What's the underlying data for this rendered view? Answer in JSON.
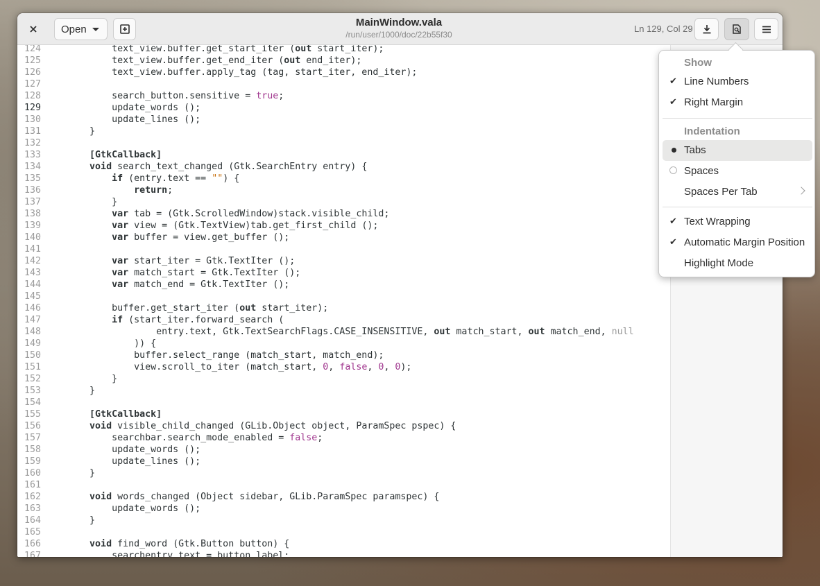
{
  "header": {
    "open_label": "Open",
    "title": "MainWindow.vala",
    "subtitle": "/run/user/1000/doc/22b55f30",
    "cursor_position": "Ln 129, Col 29"
  },
  "editor": {
    "current_line": 129,
    "lines": [
      {
        "n": 124,
        "t": [
          [
            "",
            "    text_view.buffer.get_start_iter ("
          ],
          [
            "kw",
            "out"
          ],
          [
            "",
            " start_iter);"
          ]
        ]
      },
      {
        "n": 125,
        "t": [
          [
            "",
            "    text_view.buffer.get_end_iter ("
          ],
          [
            "kw",
            "out"
          ],
          [
            "",
            " end_iter);"
          ]
        ]
      },
      {
        "n": 126,
        "t": [
          [
            "",
            "    text_view.buffer.apply_tag (tag, start_iter, end_iter);"
          ]
        ]
      },
      {
        "n": 127,
        "t": []
      },
      {
        "n": 128,
        "t": [
          [
            "",
            "    search_button.sensitive = "
          ],
          [
            "lit",
            "true"
          ],
          [
            "",
            ";"
          ]
        ]
      },
      {
        "n": 129,
        "t": [
          [
            "",
            "    update_words ();"
          ]
        ]
      },
      {
        "n": 130,
        "t": [
          [
            "",
            "    update_lines ();"
          ]
        ]
      },
      {
        "n": 131,
        "t": [
          [
            "",
            "}"
          ]
        ]
      },
      {
        "n": 132,
        "t": []
      },
      {
        "n": 133,
        "t": [
          [
            "kw",
            "[GtkCallback]"
          ]
        ]
      },
      {
        "n": 134,
        "t": [
          [
            "kw",
            "void"
          ],
          [
            "",
            " search_text_changed (Gtk.SearchEntry entry) {"
          ]
        ]
      },
      {
        "n": 135,
        "t": [
          [
            "",
            "    "
          ],
          [
            "kw",
            "if"
          ],
          [
            "",
            " (entry.text == "
          ],
          [
            "str",
            "\"\""
          ],
          [
            "",
            ") {"
          ]
        ]
      },
      {
        "n": 136,
        "t": [
          [
            "",
            "        "
          ],
          [
            "kw",
            "return"
          ],
          [
            "",
            ";"
          ]
        ]
      },
      {
        "n": 137,
        "t": [
          [
            "",
            "    }"
          ]
        ]
      },
      {
        "n": 138,
        "t": [
          [
            "",
            "    "
          ],
          [
            "kw",
            "var"
          ],
          [
            "",
            " tab = (Gtk.ScrolledWindow)stack.visible_child;"
          ]
        ]
      },
      {
        "n": 139,
        "t": [
          [
            "",
            "    "
          ],
          [
            "kw",
            "var"
          ],
          [
            "",
            " view = (Gtk.TextView)tab.get_first_child ();"
          ]
        ]
      },
      {
        "n": 140,
        "t": [
          [
            "",
            "    "
          ],
          [
            "kw",
            "var"
          ],
          [
            "",
            " buffer = view.get_buffer ();"
          ]
        ]
      },
      {
        "n": 141,
        "t": []
      },
      {
        "n": 142,
        "t": [
          [
            "",
            "    "
          ],
          [
            "kw",
            "var"
          ],
          [
            "",
            " start_iter = Gtk.TextIter ();"
          ]
        ]
      },
      {
        "n": 143,
        "t": [
          [
            "",
            "    "
          ],
          [
            "kw",
            "var"
          ],
          [
            "",
            " match_start = Gtk.TextIter ();"
          ]
        ]
      },
      {
        "n": 144,
        "t": [
          [
            "",
            "    "
          ],
          [
            "kw",
            "var"
          ],
          [
            "",
            " match_end = Gtk.TextIter ();"
          ]
        ]
      },
      {
        "n": 145,
        "t": []
      },
      {
        "n": 146,
        "t": [
          [
            "",
            "    buffer.get_start_iter ("
          ],
          [
            "kw",
            "out"
          ],
          [
            "",
            " start_iter);"
          ]
        ]
      },
      {
        "n": 147,
        "t": [
          [
            "",
            "    "
          ],
          [
            "kw",
            "if"
          ],
          [
            "",
            " (start_iter.forward_search ("
          ]
        ]
      },
      {
        "n": 148,
        "t": [
          [
            "",
            "            entry.text, Gtk.TextSearchFlags.CASE_INSENSITIVE, "
          ],
          [
            "kw",
            "out"
          ],
          [
            "",
            " match_start, "
          ],
          [
            "kw",
            "out"
          ],
          [
            "",
            " match_end, "
          ],
          [
            "dim",
            "null"
          ]
        ]
      },
      {
        "n": 149,
        "t": [
          [
            "",
            "        )) {"
          ]
        ]
      },
      {
        "n": 150,
        "t": [
          [
            "",
            "        buffer.select_range (match_start, match_end);"
          ]
        ]
      },
      {
        "n": 151,
        "t": [
          [
            "",
            "        view.scroll_to_iter (match_start, "
          ],
          [
            "lit",
            "0"
          ],
          [
            "",
            ", "
          ],
          [
            "lit",
            "false"
          ],
          [
            "",
            ", "
          ],
          [
            "lit",
            "0"
          ],
          [
            "",
            ", "
          ],
          [
            "lit",
            "0"
          ],
          [
            "",
            ");"
          ]
        ]
      },
      {
        "n": 152,
        "t": [
          [
            "",
            "    }"
          ]
        ]
      },
      {
        "n": 153,
        "t": [
          [
            "",
            "}"
          ]
        ]
      },
      {
        "n": 154,
        "t": []
      },
      {
        "n": 155,
        "t": [
          [
            "kw",
            "[GtkCallback]"
          ]
        ]
      },
      {
        "n": 156,
        "t": [
          [
            "kw",
            "void"
          ],
          [
            "",
            " visible_child_changed (GLib.Object object, ParamSpec pspec) {"
          ]
        ]
      },
      {
        "n": 157,
        "t": [
          [
            "",
            "    searchbar.search_mode_enabled = "
          ],
          [
            "lit",
            "false"
          ],
          [
            "",
            ";"
          ]
        ]
      },
      {
        "n": 158,
        "t": [
          [
            "",
            "    update_words ();"
          ]
        ]
      },
      {
        "n": 159,
        "t": [
          [
            "",
            "    update_lines ();"
          ]
        ]
      },
      {
        "n": 160,
        "t": [
          [
            "",
            "}"
          ]
        ]
      },
      {
        "n": 161,
        "t": []
      },
      {
        "n": 162,
        "t": [
          [
            "kw",
            "void"
          ],
          [
            "",
            " words_changed (Object sidebar, GLib.ParamSpec paramspec) {"
          ]
        ]
      },
      {
        "n": 163,
        "t": [
          [
            "",
            "    update_words ();"
          ]
        ]
      },
      {
        "n": 164,
        "t": [
          [
            "",
            "}"
          ]
        ]
      },
      {
        "n": 165,
        "t": []
      },
      {
        "n": 166,
        "t": [
          [
            "kw",
            "void"
          ],
          [
            "",
            " find_word (Gtk.Button button) {"
          ]
        ]
      },
      {
        "n": 167,
        "t": [
          [
            "",
            "    searchentry.text = button.label;"
          ]
        ]
      }
    ]
  },
  "menu": {
    "show_header": "Show",
    "line_numbers": "Line Numbers",
    "right_margin": "Right Margin",
    "indentation_header": "Indentation",
    "tabs": "Tabs",
    "spaces": "Spaces",
    "spaces_per_tab": "Spaces Per Tab",
    "text_wrapping": "Text Wrapping",
    "automatic_margin_position": "Automatic Margin Position",
    "highlight_mode": "Highlight Mode"
  }
}
